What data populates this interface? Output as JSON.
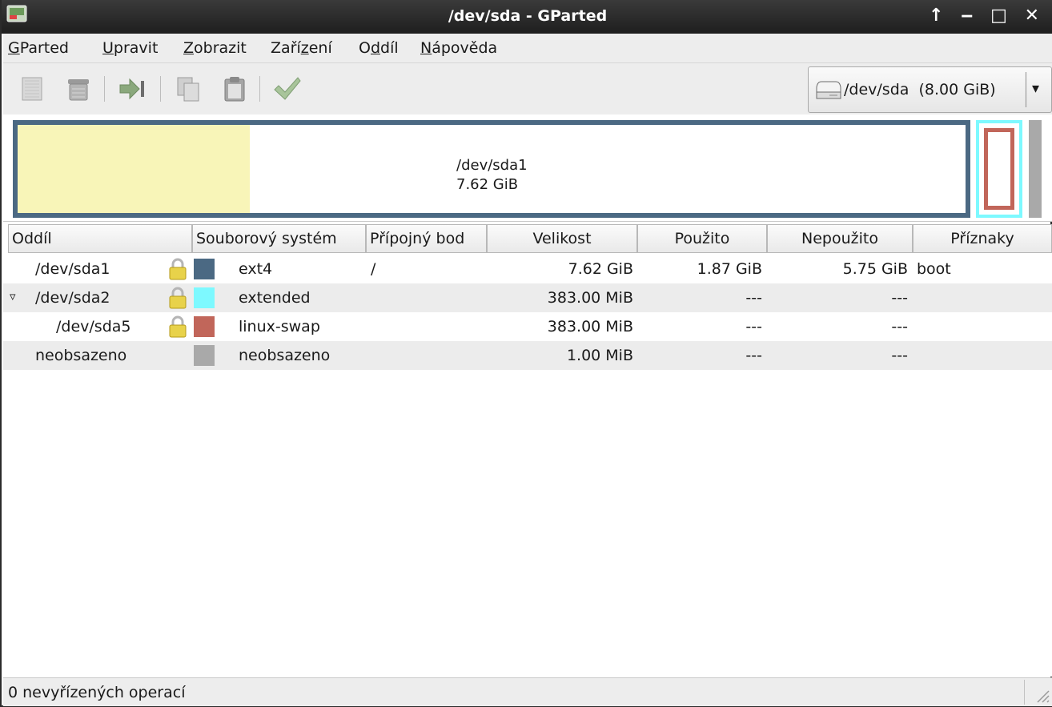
{
  "window": {
    "title": "/dev/sda - GParted",
    "controls": {
      "pin": "↑",
      "minimize": "‒",
      "maximize": "□",
      "close": "✕"
    }
  },
  "menubar": [
    {
      "label_first": "G",
      "label_rest": "Parted"
    },
    {
      "label_first": "U",
      "label_rest": "pravit"
    },
    {
      "label_first": "Z",
      "label_rest": "obrazit"
    },
    {
      "label_pre": "Zaří",
      "label_ul": "z",
      "label_post": "ení"
    },
    {
      "label_pre": "O",
      "label_ul": "d",
      "label_post": "díl"
    },
    {
      "label_first": "N",
      "label_rest": "ápověda"
    }
  ],
  "toolbar": {
    "icons": [
      "new-partition-icon",
      "delete-partition-icon",
      "resize-move-icon",
      "copy-icon",
      "paste-icon",
      "apply-icon"
    ],
    "device_selector": {
      "device": "/dev/sda",
      "size": "(8.00 GiB)",
      "arrow": "▾"
    }
  },
  "disk_map": {
    "partition_name": "/dev/sda1",
    "partition_size": "7.62 GiB",
    "used_fraction": 0.245,
    "colors": {
      "ext4": "#4b6983",
      "extended": "#7df9ff",
      "linux_swap": "#c1665a",
      "unallocated": "#a9a9a9",
      "used": "#f8f5b8"
    }
  },
  "table": {
    "headers": [
      "Oddíl",
      "Souborový systém",
      "Přípojný bod",
      "Velikost",
      "Použito",
      "Nepoužito",
      "Příznaky"
    ],
    "rows": [
      {
        "partition": "/dev/sda1",
        "locked": true,
        "color": "#4b6983",
        "filesystem": "ext4",
        "mount": "/",
        "size": "7.62 GiB",
        "used": "1.87 GiB",
        "unused": "5.75 GiB",
        "flags": "boot"
      },
      {
        "partition": "/dev/sda2",
        "expander": "▿",
        "locked": true,
        "color": "#7df9ff",
        "filesystem": "extended",
        "mount": "",
        "size": "383.00 MiB",
        "used": "---",
        "unused": "---",
        "flags": ""
      },
      {
        "partition": "/dev/sda5",
        "locked": true,
        "color": "#c1665a",
        "filesystem": "linux-swap",
        "mount": "",
        "size": "383.00 MiB",
        "used": "---",
        "unused": "---",
        "flags": ""
      },
      {
        "partition": "neobsazeno",
        "locked": false,
        "color": "#a9a9a9",
        "filesystem": "neobsazeno",
        "mount": "",
        "size": "1.00 MiB",
        "used": "---",
        "unused": "---",
        "flags": ""
      }
    ]
  },
  "statusbar": {
    "text": "0 nevyřízených operací"
  }
}
